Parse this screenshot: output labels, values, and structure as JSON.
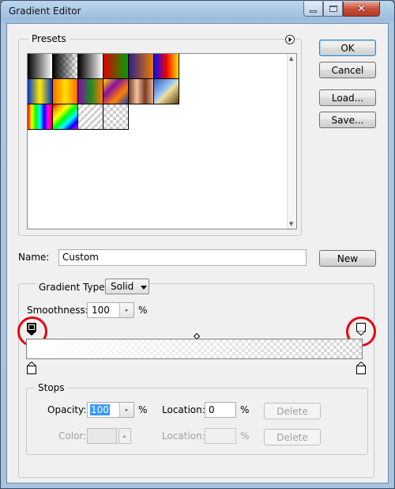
{
  "window": {
    "title": "Gradient Editor"
  },
  "titlebar_buttons": {
    "close": "✕"
  },
  "presets": {
    "label": "Presets",
    "menu_icon": "circle-arrow-right-icon",
    "swatches": [
      {
        "name": "foreground-to-background",
        "css": "linear-gradient(to right,#000,#fff)"
      },
      {
        "name": "foreground-to-transparent",
        "css": "checker-black"
      },
      {
        "name": "black-white",
        "css": "linear-gradient(to right,#000,#fff)"
      },
      {
        "name": "red-green",
        "css": "linear-gradient(to right,#e00000,#00a000)"
      },
      {
        "name": "violet-orange",
        "css": "linear-gradient(to right,#2a1e8c,#f07d00)"
      },
      {
        "name": "blue-red-yellow",
        "css": "linear-gradient(to right,#0010ff,#f00000,#ffe000)"
      },
      {
        "name": "blue-yellow-blue",
        "css": "linear-gradient(to right,#0033cc,#ffee00,#0033cc)"
      },
      {
        "name": "orange-yellow-orange",
        "css": "linear-gradient(to right,#ff6a00,#ffe100,#ff6a00)"
      },
      {
        "name": "violet-green-orange",
        "css": "linear-gradient(to right,#8a0aa0,#1a8a2a,#ff7a00)"
      },
      {
        "name": "yellow-violet-orange-blue",
        "css": "linear-gradient(135deg,#ffe000,#8a10a0,#ff8000,#1a40c0)"
      },
      {
        "name": "copper",
        "css": "linear-gradient(to right,#7a3a20,#f2c2a4,#7a3a20,#e8b090)"
      },
      {
        "name": "chrome",
        "css": "linear-gradient(135deg,#3060c0,#a0c8f0 45%,#f0e0a0 55%,#604010)"
      },
      {
        "name": "spectrum",
        "css": "linear-gradient(to right,red,yellow,lime,cyan,blue,magenta,red)"
      },
      {
        "name": "transparent-rainbow",
        "css": "linear-gradient(135deg,red,orange,yellow,lime,cyan,blue,magenta)"
      },
      {
        "name": "transparent-stripes",
        "css": "checker-stripes"
      },
      {
        "name": "neutral-density",
        "css": "checker"
      }
    ]
  },
  "buttons": {
    "ok": "OK",
    "cancel": "Cancel",
    "load": "Load...",
    "save": "Save...",
    "new": "New"
  },
  "name_field": {
    "label": "Name:",
    "value": "Custom"
  },
  "gradient_type": {
    "label": "Gradient Type:",
    "value": "Solid"
  },
  "smoothness": {
    "label": "Smoothness:",
    "value": "100",
    "unit": "%"
  },
  "stops": {
    "label": "Stops",
    "opacity_label": "Opacity:",
    "opacity_value": "100",
    "opacity_unit": "%",
    "location_label": "Location:",
    "location_value": "0",
    "location_unit": "%",
    "delete_label": "Delete",
    "color_label": "Color:",
    "color_location_label": "Location:",
    "color_location_unit": "%",
    "color_delete_label": "Delete"
  },
  "colors": {
    "highlight": "#e30613",
    "selection": "#3399ff"
  }
}
